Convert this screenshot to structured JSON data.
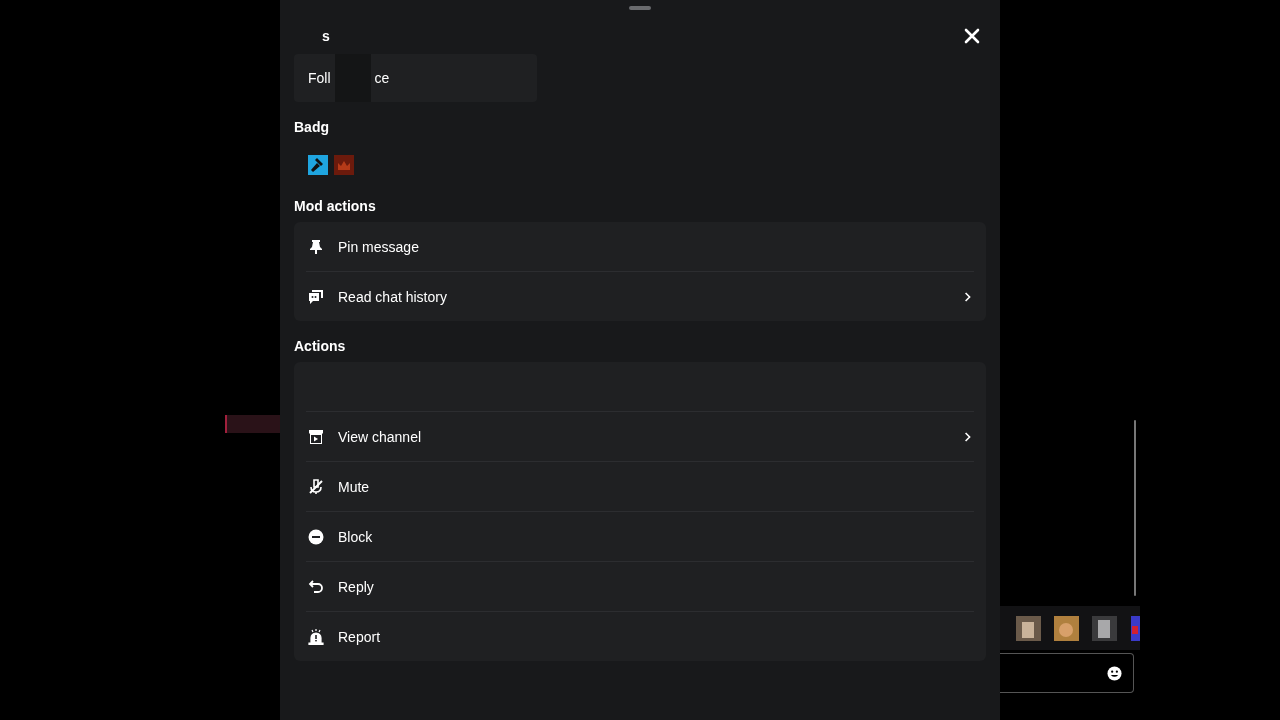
{
  "header": {
    "username": "s"
  },
  "info_card": {
    "text_start": "Foll",
    "text_end": "ce"
  },
  "badges": {
    "title": "Badg",
    "items": [
      {
        "kind": "moderator"
      },
      {
        "kind": "subscriber"
      }
    ]
  },
  "mod_actions": {
    "title": "Mod actions",
    "items": [
      {
        "kind": "pin",
        "label": "Pin message",
        "chevron": false
      },
      {
        "kind": "history",
        "label": "Read chat history",
        "chevron": true
      }
    ]
  },
  "actions": {
    "title": "Actions",
    "items": [
      {
        "kind": "blank"
      },
      {
        "kind": "channel",
        "label": "View channel",
        "chevron": true
      },
      {
        "kind": "mute",
        "label": "Mute",
        "chevron": false
      },
      {
        "kind": "block",
        "label": "Block",
        "chevron": false
      },
      {
        "kind": "reply",
        "label": "Reply",
        "chevron": false
      },
      {
        "kind": "report",
        "label": "Report",
        "chevron": false
      }
    ]
  }
}
